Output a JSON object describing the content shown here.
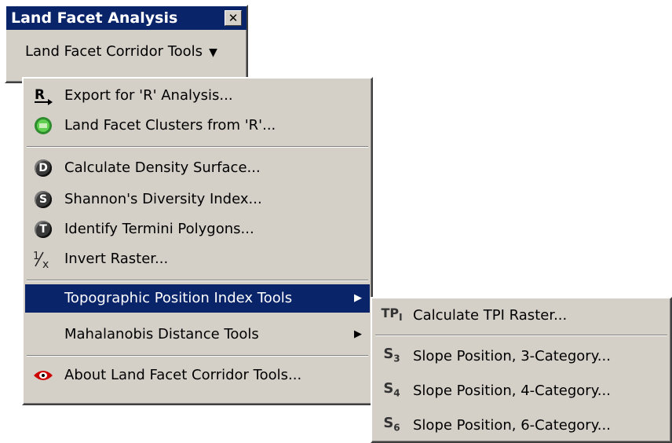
{
  "toolbar": {
    "title": "Land Facet Analysis",
    "close_glyph": "✕",
    "dropdown_label": "Land Facet Corridor Tools",
    "dropdown_arrow": "▼"
  },
  "menu": {
    "items": [
      {
        "label": "Export for 'R' Analysis...",
        "icon": "r-export-icon"
      },
      {
        "label": "Land Facet Clusters from 'R'...",
        "icon": "green-cluster-icon"
      },
      {
        "label": "Calculate Density Surface...",
        "icon": "d-circle-icon",
        "glyph": "D"
      },
      {
        "label": "Shannon's Diversity Index...",
        "icon": "s-circle-icon",
        "glyph": "S"
      },
      {
        "label": "Identify Termini Polygons...",
        "icon": "t-circle-icon",
        "glyph": "T"
      },
      {
        "label": "Invert Raster...",
        "icon": "invert-icon"
      },
      {
        "label": "Topographic Position Index Tools",
        "submenu": true
      },
      {
        "label": "Mahalanobis Distance Tools",
        "submenu": true
      },
      {
        "label": "About Land Facet Corridor Tools...",
        "icon": "eye-icon"
      }
    ]
  },
  "submenu": {
    "items": [
      {
        "label": "Calculate TPI Raster...",
        "icon": "tpi-icon"
      },
      {
        "label": "Slope Position, 3-Category...",
        "icon": "s3-icon"
      },
      {
        "label": "Slope Position, 4-Category...",
        "icon": "s4-icon"
      },
      {
        "label": "Slope Position, 6-Category...",
        "icon": "s6-icon"
      }
    ]
  },
  "colors": {
    "menu_bg": "#d4d0c8",
    "highlight": "#0a246a",
    "highlight_text": "#ffffff"
  }
}
